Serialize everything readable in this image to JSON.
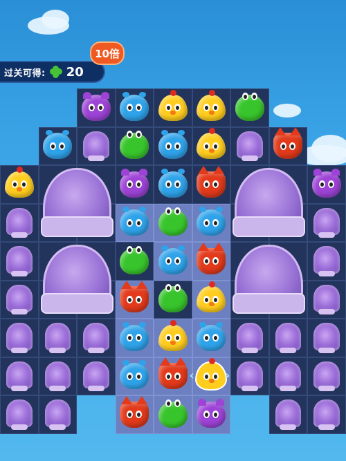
{
  "hud": {
    "label": "过关可得:",
    "reward_icon": "clover-icon",
    "reward_count": "20"
  },
  "multiplier_badge": "10倍",
  "colors": {
    "board": "#22345c",
    "board_light": "#6b7fc1",
    "owl": "#9d43d6",
    "hippo": "#2fa3ea",
    "chick": "#ffcd1e",
    "frog": "#38c52c",
    "fox": "#e23a1b",
    "dome": "#9d6fd9"
  }
}
